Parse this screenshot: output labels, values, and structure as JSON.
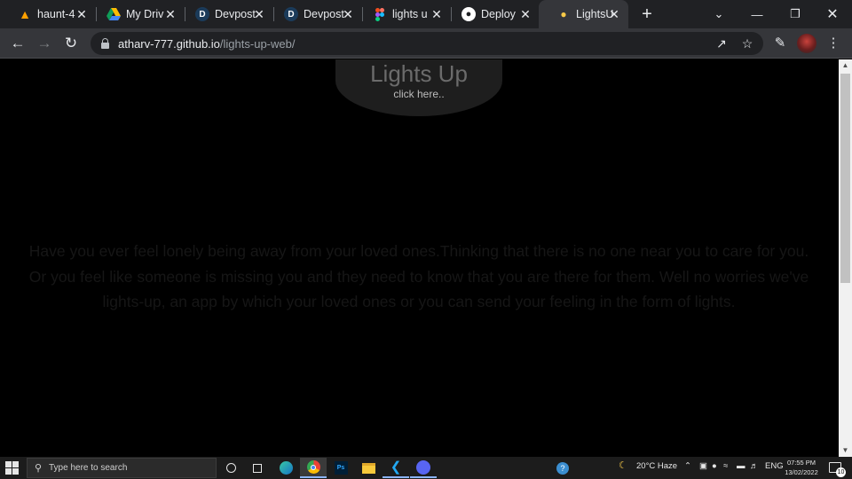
{
  "browser": {
    "tabs": [
      {
        "title": "haunt-4",
        "icon": "firebase-icon",
        "active": false
      },
      {
        "title": "My Driv",
        "icon": "google-drive-icon",
        "active": false
      },
      {
        "title": "Devpost",
        "icon": "devpost-icon",
        "active": false
      },
      {
        "title": "Devpost",
        "icon": "devpost-icon",
        "active": false
      },
      {
        "title": "lights u",
        "icon": "figma-icon",
        "active": false
      },
      {
        "title": "Deploy",
        "icon": "github-icon",
        "active": false
      },
      {
        "title": "LightsU",
        "icon": "lightbulb-icon",
        "active": true
      }
    ],
    "address": {
      "host": "atharv-777.github.io",
      "path": "/lights-up-web/"
    }
  },
  "page": {
    "title": "Lights Up",
    "subtitle": "click here..",
    "body": "Have you ever feel lonely being away from your loved ones.Thinking that there is no one near you to care for you. Or you feel like someone is missing you and they need to know that you are there for them. Well no worries we've lights-up, an app by which your loved ones or you can send your feeling in the form of lights."
  },
  "taskbar": {
    "search_placeholder": "Type here to search",
    "weather": "20°C  Haze",
    "language": "ENG",
    "time": "07:55 PM",
    "date": "13/02/2022",
    "notification_count": "10"
  },
  "colors": {
    "tab_strip": "#202124",
    "toolbar": "#35363a",
    "page_background": "#000000",
    "title_color": "#6b6b6b"
  }
}
